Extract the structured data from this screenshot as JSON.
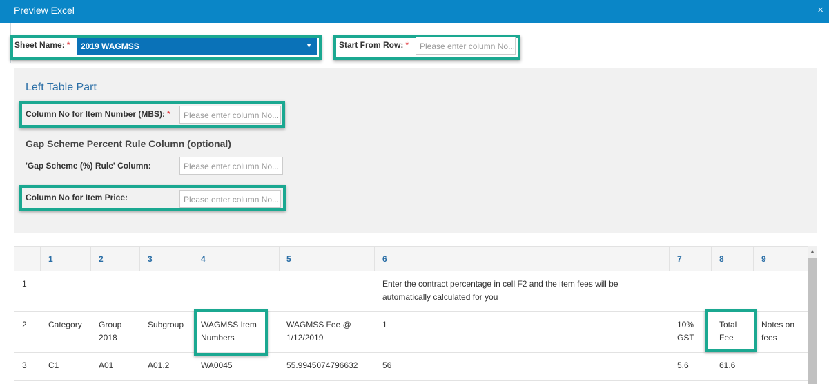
{
  "dialog": {
    "title": "Preview Excel",
    "close_glyph": "×"
  },
  "sheet": {
    "label": "Sheet Name:",
    "required": "*",
    "value": "2019 WAGMSS",
    "arrow": "▼"
  },
  "start_row": {
    "label": "Start From Row:",
    "required": "*",
    "placeholder": "Please enter column No..."
  },
  "left_table": {
    "title": "Left Table Part",
    "item_number": {
      "label": "Column No for Item Number (MBS):",
      "required": "*",
      "placeholder": "Please enter column No..."
    },
    "gap_heading": "Gap Scheme Percent Rule Column (optional)",
    "gap_column": {
      "label": "'Gap Scheme (%) Rule' Column:",
      "placeholder": "Please enter column No..."
    },
    "item_price": {
      "label": "Column No for Item Price:",
      "placeholder": "Please enter column No..."
    }
  },
  "grid": {
    "columns": [
      "1",
      "2",
      "3",
      "4",
      "5",
      "6",
      "7",
      "8",
      "9"
    ],
    "rows": [
      {
        "num": "1",
        "cells": [
          "",
          "",
          "",
          "",
          "",
          "Enter the contract percentage in cell F2 and the item fees will be automatically calculated for you",
          "",
          "",
          ""
        ]
      },
      {
        "num": "2",
        "cells": [
          "Category",
          "Group 2018",
          "Subgroup",
          "WAGMSS Item Numbers",
          "WAGMSS Fee @ 1/12/2019",
          "1",
          "10% GST",
          "Total Fee",
          "Notes on fees"
        ]
      },
      {
        "num": "3",
        "cells": [
          "C1",
          "A01",
          "A01.2",
          "WA0045",
          "55.9945074796632",
          "56",
          "5.6",
          "61.6",
          ""
        ]
      }
    ]
  },
  "colors": {
    "titlebar": "#0a86c7",
    "highlight": "#1ba891",
    "select_bg": "#0a72b8",
    "link": "#2a6ea6"
  },
  "icons": {
    "close": "close-icon",
    "dropdown": "chevron-down-icon"
  }
}
